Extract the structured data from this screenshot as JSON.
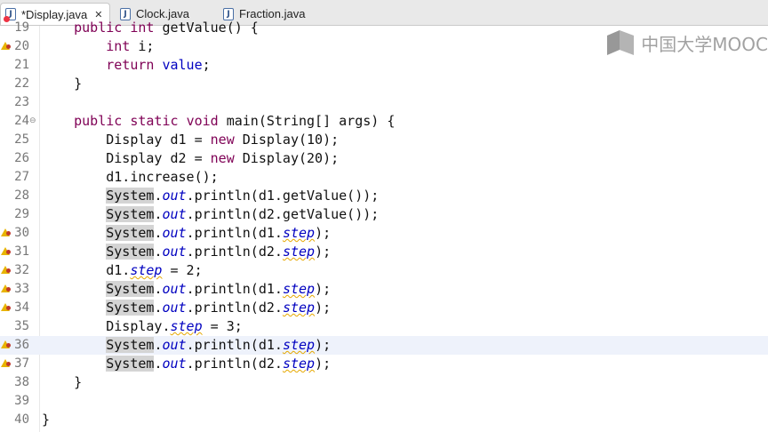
{
  "tabs": [
    {
      "label": "*Display.java",
      "active": true,
      "closable": true,
      "icon": "java-file-error-icon"
    },
    {
      "label": "Clock.java",
      "active": false,
      "icon": "java-file-icon"
    },
    {
      "label": "Fraction.java",
      "active": false,
      "icon": "java-file-icon"
    }
  ],
  "watermark": {
    "text": "中国大学MOOC"
  },
  "lines": [
    {
      "n": "19",
      "code": "    public int getValue() {"
    },
    {
      "n": "20",
      "code": "        int i;"
    },
    {
      "n": "21",
      "code": "        return value;"
    },
    {
      "n": "22",
      "code": "    }"
    },
    {
      "n": "23",
      "code": ""
    },
    {
      "n": "24",
      "code": "    public static void main(String[] args) {"
    },
    {
      "n": "25",
      "code": "        Display d1 = new Display(10);"
    },
    {
      "n": "26",
      "code": "        Display d2 = new Display(20);"
    },
    {
      "n": "27",
      "code": "        d1.increase();"
    },
    {
      "n": "28",
      "code": "        System.out.println(d1.getValue());"
    },
    {
      "n": "29",
      "code": "        System.out.println(d2.getValue());"
    },
    {
      "n": "30",
      "code": "        System.out.println(d1.step);"
    },
    {
      "n": "31",
      "code": "        System.out.println(d2.step);"
    },
    {
      "n": "32",
      "code": "        d1.step = 2;"
    },
    {
      "n": "33",
      "code": "        System.out.println(d1.step);"
    },
    {
      "n": "34",
      "code": "        System.out.println(d2.step);"
    },
    {
      "n": "35",
      "code": "        Display.step = 3;"
    },
    {
      "n": "36",
      "code": "        System.out.println(d1.step);"
    },
    {
      "n": "37",
      "code": "        System.out.println(d2.step);"
    },
    {
      "n": "38",
      "code": "    }"
    },
    {
      "n": "39",
      "code": ""
    },
    {
      "n": "40",
      "code": "}"
    }
  ],
  "colors": {
    "keyword": "#7f0055",
    "field": "#0000c0",
    "current_line": "#eef2fb",
    "warning": "#e8b400"
  }
}
